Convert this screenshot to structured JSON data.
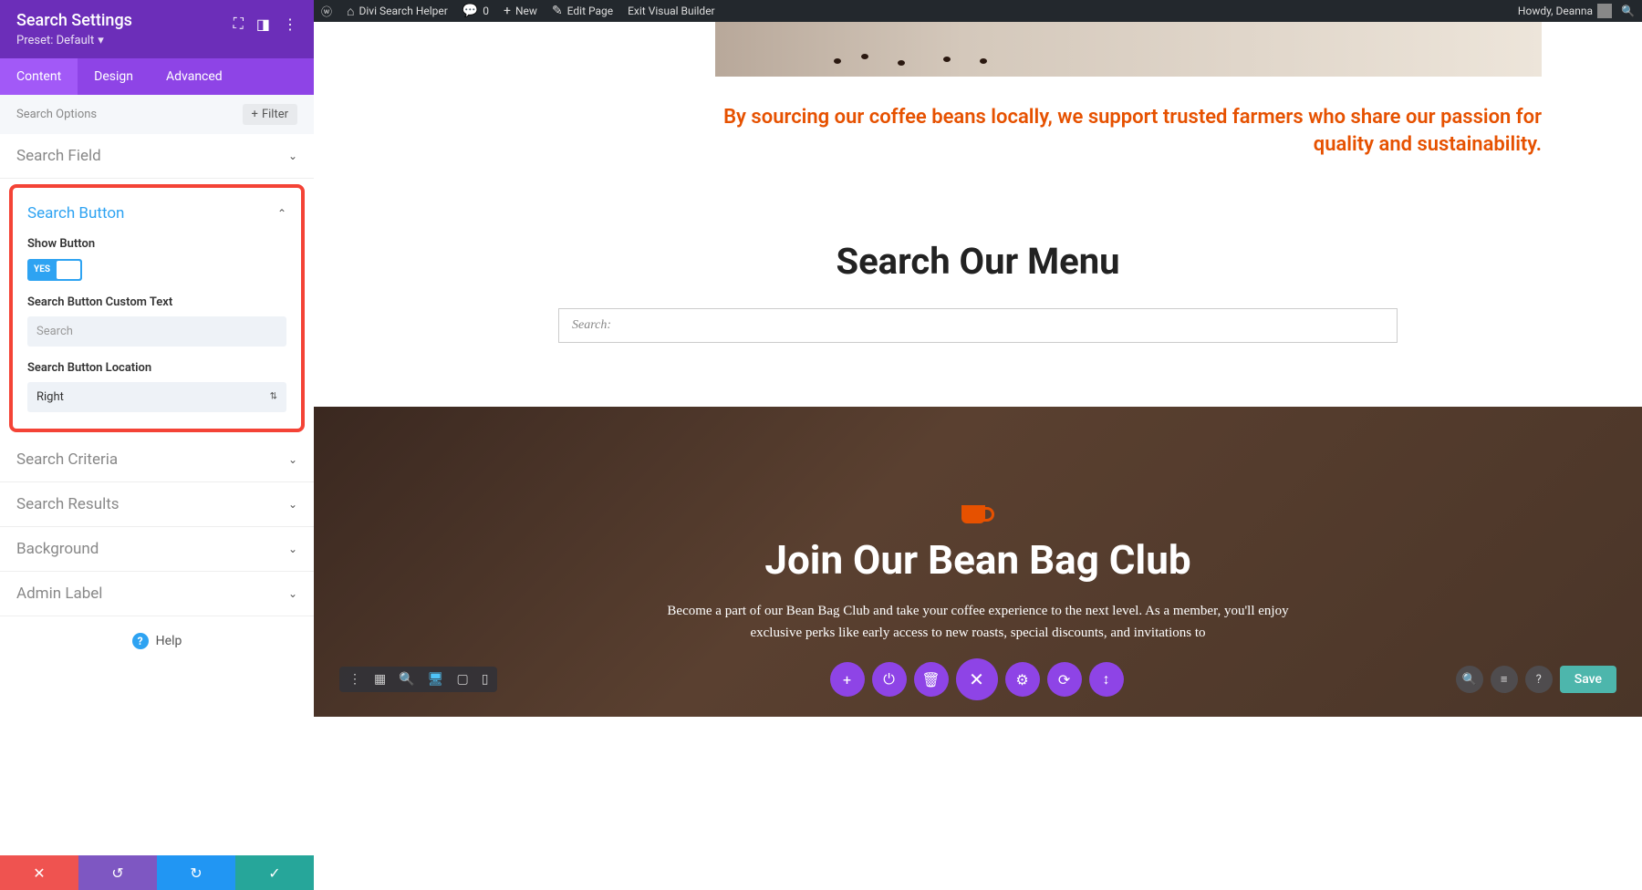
{
  "wp_bar": {
    "site_name": "Divi Search Helper",
    "comments": "0",
    "new_label": "New",
    "edit_page": "Edit Page",
    "exit_builder": "Exit Visual Builder",
    "howdy": "Howdy, Deanna"
  },
  "sidebar": {
    "title": "Search Settings",
    "preset": "Preset: Default",
    "tabs": [
      "Content",
      "Design",
      "Advanced"
    ],
    "active_tab": 0,
    "search_options_label": "Search Options",
    "filter_label": "Filter",
    "sections": {
      "search_field": "Search Field",
      "search_button": "Search Button",
      "search_criteria": "Search Criteria",
      "search_results": "Search Results",
      "background": "Background",
      "admin_label": "Admin Label"
    },
    "search_button": {
      "show_button_label": "Show Button",
      "show_button_value": "YES",
      "custom_text_label": "Search Button Custom Text",
      "custom_text_placeholder": "Search",
      "location_label": "Search Button Location",
      "location_value": "Right"
    },
    "help_label": "Help"
  },
  "content": {
    "tagline": "By sourcing our coffee beans locally, we support trusted farmers who share our passion for quality and sustainability.",
    "search_heading": "Search Our Menu",
    "search_placeholder": "Search:",
    "club_heading": "Join Our Bean Bag Club",
    "club_text": "Become a part of our Bean Bag Club and take your coffee experience to the next level. As a member, you'll enjoy exclusive perks like early access to new roasts, special discounts, and invitations to"
  },
  "toolbar": {
    "save_label": "Save"
  },
  "colors": {
    "accent": "#e65100",
    "purple": "#8e44e6"
  }
}
